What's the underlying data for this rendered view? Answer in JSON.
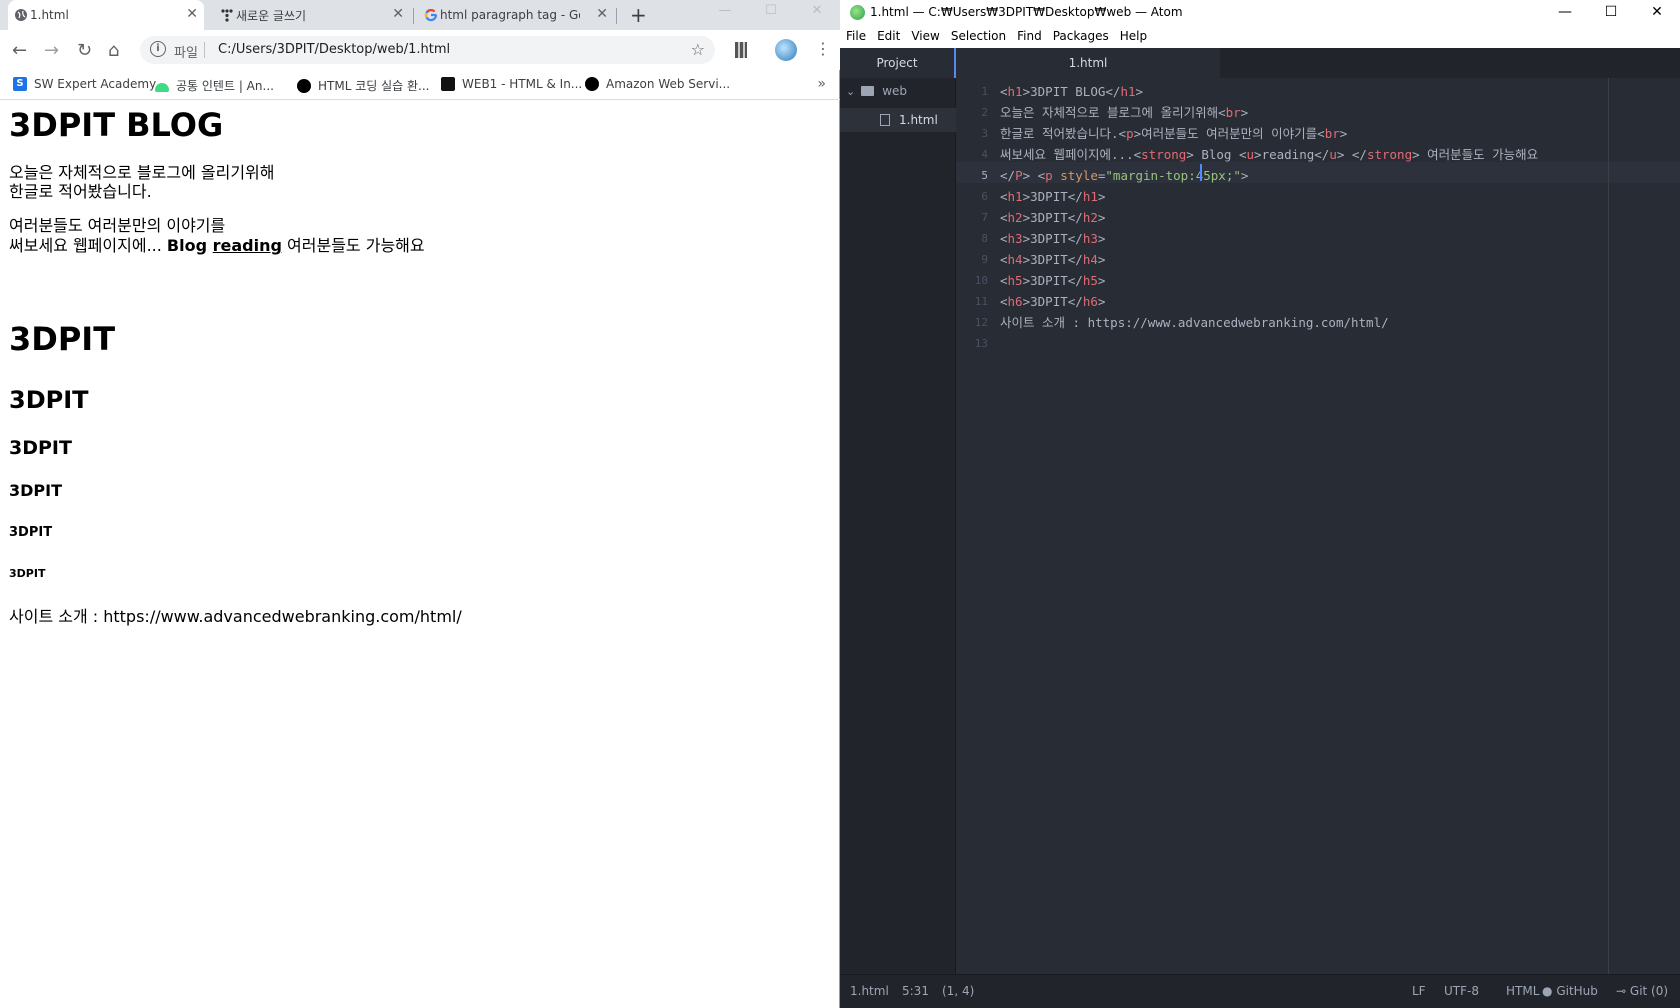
{
  "chrome": {
    "tabs": [
      {
        "label": "1.html",
        "close": "✕"
      },
      {
        "label": "새로운 글쓰기",
        "close": "✕"
      },
      {
        "label": "html paragraph tag - Go",
        "close": "✕"
      }
    ],
    "newtab": "+",
    "window_controls": [
      "—",
      "☐",
      "✕"
    ],
    "nav": {
      "back": "←",
      "forward": "→",
      "reload": "↻",
      "home": "⌂"
    },
    "omnibox": {
      "info": "i",
      "scheme": "파일",
      "url": "C:/Users/3DPIT/Desktop/web/1.html",
      "star": "☆"
    },
    "menu": "⋮",
    "bookmarks": [
      {
        "label": "SW Expert Academy",
        "icon": "sw-expert-icon",
        "color": "#1a73e8"
      },
      {
        "label": "공통 인텐트 | An...",
        "icon": "android-icon",
        "color": "#3ddc84"
      },
      {
        "label": "HTML 코딩 실습 환...",
        "icon": "black-circle-icon",
        "color": "#000000"
      },
      {
        "label": "WEB1 - HTML & In...",
        "icon": "web1-icon",
        "color": "#111111"
      },
      {
        "label": "Amazon Web Servi...",
        "icon": "black-circle-icon",
        "color": "#000000"
      }
    ],
    "bookmarks_more": "»",
    "page": {
      "h1": "3DPIT BLOG",
      "p1_line1": "오늘은 자체적으로 블로그에 올리기위해",
      "p1_line2": "한글로 적어봤습니다.",
      "p2_line1": "여러분들도 여러분만의 이야기를",
      "p2_line2_a": "써보세요 웹페이지에... ",
      "p2_strong": "Blog ",
      "p2_underline": "reading",
      "p2_line2_b": " 여러분들도 가능해요",
      "headings": [
        "3DPIT",
        "3DPIT",
        "3DPIT",
        "3DPIT",
        "3DPIT",
        "3DPIT"
      ],
      "footer": "사이트 소개 : https://www.advancedwebranking.com/html/"
    }
  },
  "atom": {
    "title": "1.html — C:₩Users₩3DPIT₩Desktop₩web — Atom",
    "window_controls": [
      "—",
      "☐",
      "✕"
    ],
    "menu": [
      "File",
      "Edit",
      "View",
      "Selection",
      "Find",
      "Packages",
      "Help"
    ],
    "tree": {
      "header": "Project",
      "root": "web",
      "chevron": "⌄",
      "file": "1.html"
    },
    "tab": "1.html",
    "line_numbers": [
      "1",
      "2",
      "3",
      "4",
      "5",
      "6",
      "7",
      "8",
      "9",
      "10",
      "11",
      "12",
      "13"
    ],
    "current_line": 5,
    "status": {
      "file": "1.html",
      "cursor": "5:31",
      "selection": "(1, 4)",
      "eol": "LF",
      "encoding": "UTF-8",
      "grammar": "HTML",
      "github": "GitHub",
      "git": "Git (0)"
    },
    "colors": {
      "tag": "#e06c75",
      "text": "#abb2bf",
      "attr": "#d19a66",
      "string": "#98c379",
      "accent": "#568af2"
    }
  }
}
